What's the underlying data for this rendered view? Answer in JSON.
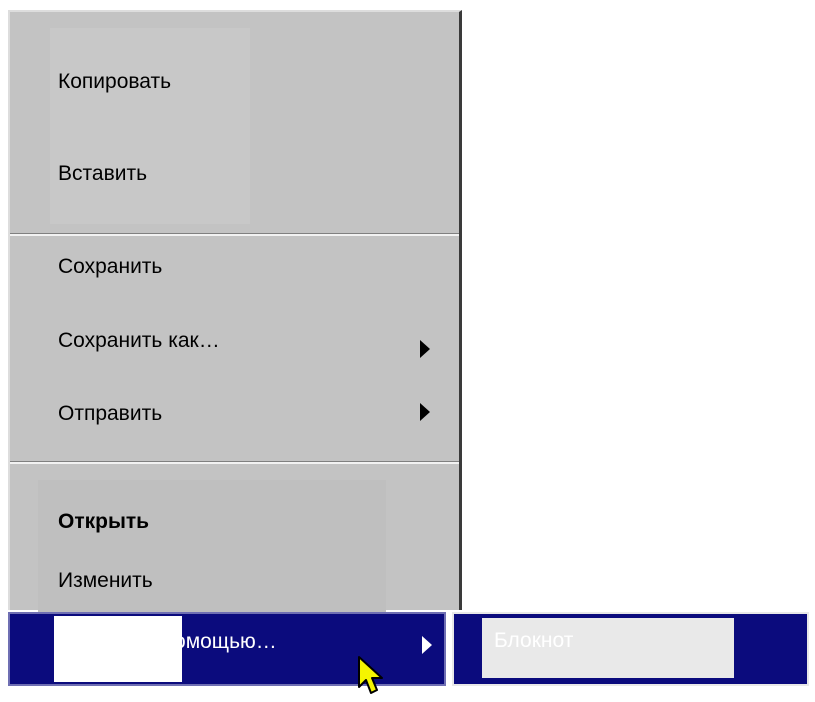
{
  "context_menu": {
    "items": [
      {
        "label": "Копировать"
      },
      {
        "label": "Вставить"
      },
      {
        "label": "Сохранить"
      },
      {
        "label": "Сохранить как…",
        "has_submenu": true
      },
      {
        "label": "Отправить",
        "has_submenu": true
      },
      {
        "label": "Открыть",
        "bold": true
      },
      {
        "label": "Изменить"
      }
    ],
    "highlighted_item": {
      "label": "Открыть с помощью…",
      "has_submenu": true
    }
  },
  "submenu": {
    "items": [
      {
        "label": "Блокнот"
      }
    ]
  },
  "colors": {
    "menu_background": "#c3c3c3",
    "highlight_background": "#0b0b7d",
    "highlight_text": "#ffffff",
    "cursor_fill": "#f5f500"
  },
  "icons": {
    "submenu_arrow": "triangle-right-icon",
    "pointer": "mouse-pointer-icon"
  }
}
